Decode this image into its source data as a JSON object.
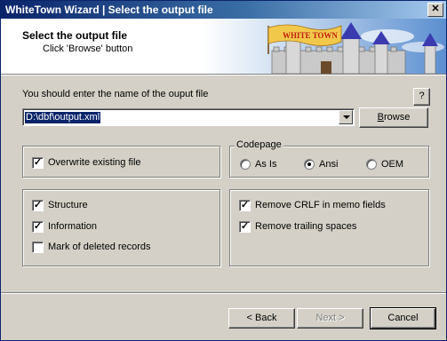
{
  "window": {
    "title": "WhiteTown Wizard | Select the output file",
    "close_glyph": "✕"
  },
  "header": {
    "title": "Select the output file",
    "subtitle": "Click 'Browse' button",
    "banner_text": "WHITE TOWN"
  },
  "file": {
    "prompt": "You should enter the name of the ouput file",
    "help_label": "?",
    "path": "D:\\dbf\\output.xml",
    "browse_label": "Browse"
  },
  "overwrite": {
    "label": "Overwrite existing file",
    "checked": true
  },
  "codepage": {
    "title": "Codepage",
    "options": [
      {
        "label": "As Is",
        "selected": false
      },
      {
        "label": "Ansi",
        "selected": true
      },
      {
        "label": "OEM",
        "selected": false
      }
    ]
  },
  "content_options": [
    {
      "label": "Structure",
      "checked": true
    },
    {
      "label": "Information",
      "checked": true
    },
    {
      "label": "Mark of deleted records",
      "checked": false
    }
  ],
  "memo_options": [
    {
      "label": "Remove CRLF in memo fields",
      "checked": true
    },
    {
      "label": "Remove trailing spaces",
      "checked": true
    }
  ],
  "nav": {
    "back_label": "< Back",
    "next_label": "Next >",
    "cancel_label": "Cancel"
  },
  "colors": {
    "titlebar_start": "#0a246a",
    "titlebar_end": "#a6caf0",
    "face": "#d4d0c8",
    "selection": "#0a246a"
  }
}
